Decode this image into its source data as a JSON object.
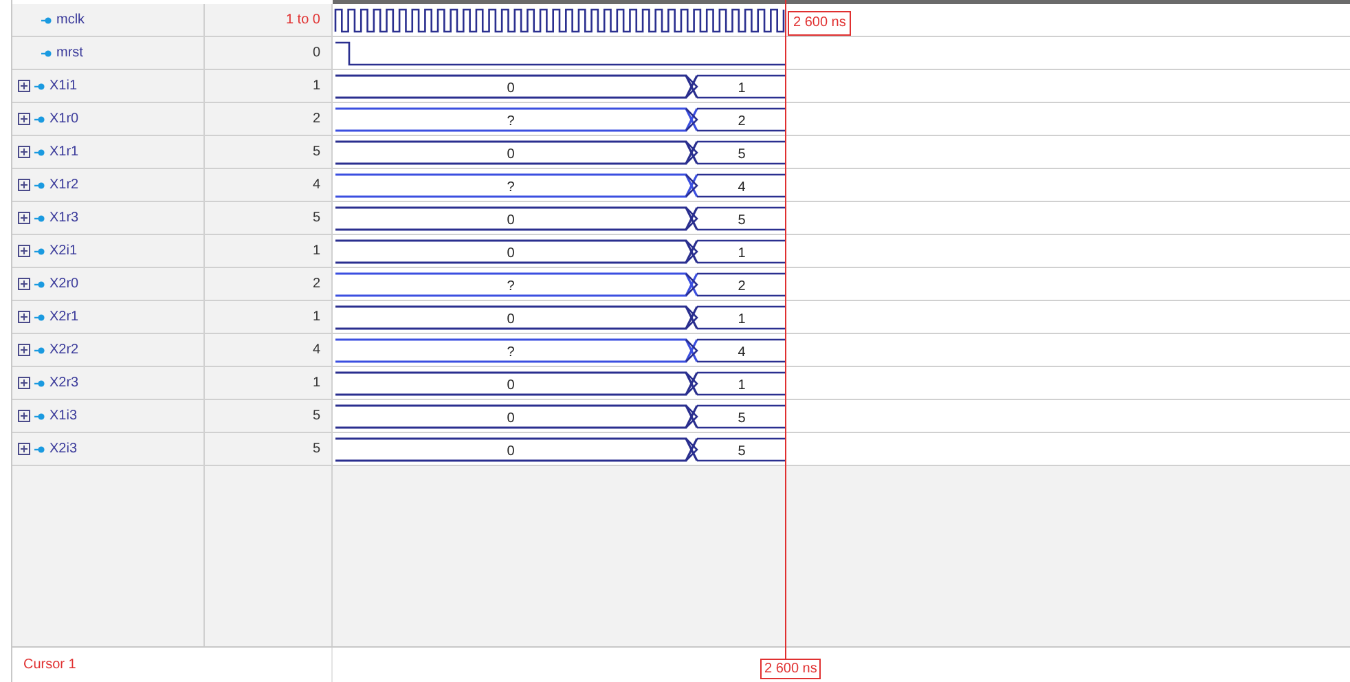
{
  "signals": [
    {
      "name": "mclk",
      "kind": "clock",
      "expandable": false,
      "value": "1 to 0"
    },
    {
      "name": "mrst",
      "kind": "reset",
      "expandable": false,
      "value": "0"
    },
    {
      "name": "X1i1",
      "kind": "bus",
      "expandable": true,
      "value": "1",
      "uninitialized": false,
      "segments": [
        "0",
        "1"
      ]
    },
    {
      "name": "X1r0",
      "kind": "bus",
      "expandable": true,
      "value": "2",
      "uninitialized": true,
      "segments": [
        "?",
        "2"
      ]
    },
    {
      "name": "X1r1",
      "kind": "bus",
      "expandable": true,
      "value": "5",
      "uninitialized": false,
      "segments": [
        "0",
        "5"
      ]
    },
    {
      "name": "X1r2",
      "kind": "bus",
      "expandable": true,
      "value": "4",
      "uninitialized": true,
      "segments": [
        "?",
        "4"
      ]
    },
    {
      "name": "X1r3",
      "kind": "bus",
      "expandable": true,
      "value": "5",
      "uninitialized": false,
      "segments": [
        "0",
        "5"
      ]
    },
    {
      "name": "X2i1",
      "kind": "bus",
      "expandable": true,
      "value": "1",
      "uninitialized": false,
      "segments": [
        "0",
        "1"
      ]
    },
    {
      "name": "X2r0",
      "kind": "bus",
      "expandable": true,
      "value": "2",
      "uninitialized": true,
      "segments": [
        "?",
        "2"
      ]
    },
    {
      "name": "X2r1",
      "kind": "bus",
      "expandable": true,
      "value": "1",
      "uninitialized": false,
      "segments": [
        "0",
        "1"
      ]
    },
    {
      "name": "X2r2",
      "kind": "bus",
      "expandable": true,
      "value": "4",
      "uninitialized": true,
      "segments": [
        "?",
        "4"
      ]
    },
    {
      "name": "X2r3",
      "kind": "bus",
      "expandable": true,
      "value": "1",
      "uninitialized": false,
      "segments": [
        "0",
        "1"
      ]
    },
    {
      "name": "X1i3",
      "kind": "bus",
      "expandable": true,
      "value": "5",
      "uninitialized": false,
      "segments": [
        "0",
        "5"
      ]
    },
    {
      "name": "X2i3",
      "kind": "bus",
      "expandable": true,
      "value": "5",
      "uninitialized": false,
      "segments": [
        "0",
        "5"
      ]
    }
  ],
  "cursor": {
    "name": "Cursor 1",
    "time_top": "2 600 ns",
    "time_bottom": "2 600 ns"
  }
}
